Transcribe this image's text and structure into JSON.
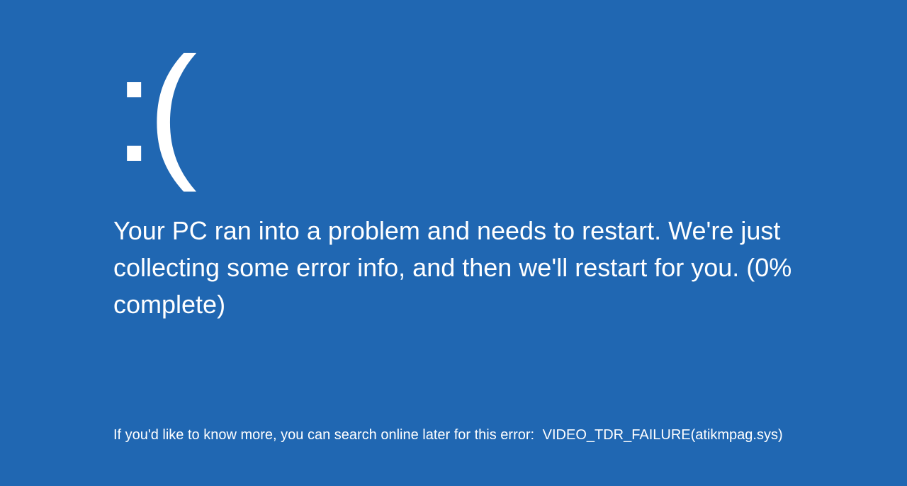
{
  "bsod": {
    "sad_face": ":(",
    "message": "Your PC ran into a problem and needs to restart. We're just collecting some error info, and then we'll restart for you. (0% complete)",
    "footer_prefix": "If you'd like to know more, you can search online later for this error:",
    "error_code": "VIDEO_TDR_FAILURE(atikmpag.sys)"
  }
}
